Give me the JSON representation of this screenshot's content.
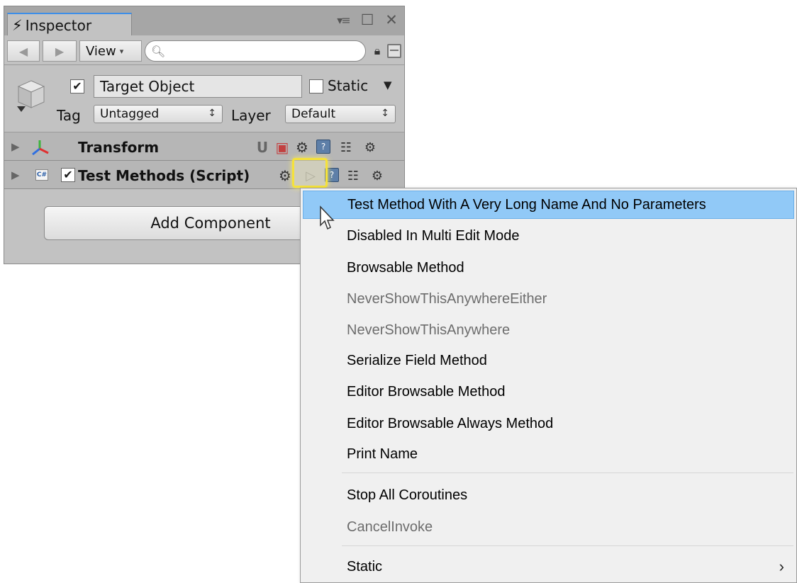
{
  "inspector": {
    "tab_label": "Inspector",
    "toolbar": {
      "view_label": "View",
      "search_placeholder": ""
    },
    "object": {
      "name": "Target Object",
      "active": true,
      "static_label": "Static",
      "static_checked": false,
      "tag_label": "Tag",
      "tag_value": "Untagged",
      "layer_label": "Layer",
      "layer_value": "Default"
    },
    "components": [
      {
        "title": "Transform"
      },
      {
        "title": "Test Methods (Script)",
        "enabled": true
      }
    ],
    "add_component_label": "Add Component"
  },
  "context_menu": {
    "items": [
      {
        "label": "Test Method With A Very Long Name And No Parameters",
        "state": "highlighted"
      },
      {
        "label": "Disabled In Multi Edit Mode",
        "state": "normal"
      },
      {
        "label": "Browsable Method",
        "state": "normal"
      },
      {
        "label": "NeverShowThisAnywhereEither",
        "state": "disabled"
      },
      {
        "label": "NeverShowThisAnywhere",
        "state": "disabled"
      },
      {
        "label": "Serialize Field Method",
        "state": "normal"
      },
      {
        "label": "Editor Browsable Method",
        "state": "normal"
      },
      {
        "label": "Editor Browsable Always Method",
        "state": "normal"
      },
      {
        "label": "Print Name",
        "state": "normal"
      },
      {
        "label": "Stop All Coroutines",
        "state": "normal"
      },
      {
        "label": "CancelInvoke",
        "state": "disabled"
      },
      {
        "label": "Static",
        "state": "normal",
        "submenu": true
      }
    ]
  },
  "colors": {
    "menu_highlight": "#91c9f7",
    "play_highlight": "#f5e23a",
    "tab_accent": "#3d8ee8"
  }
}
